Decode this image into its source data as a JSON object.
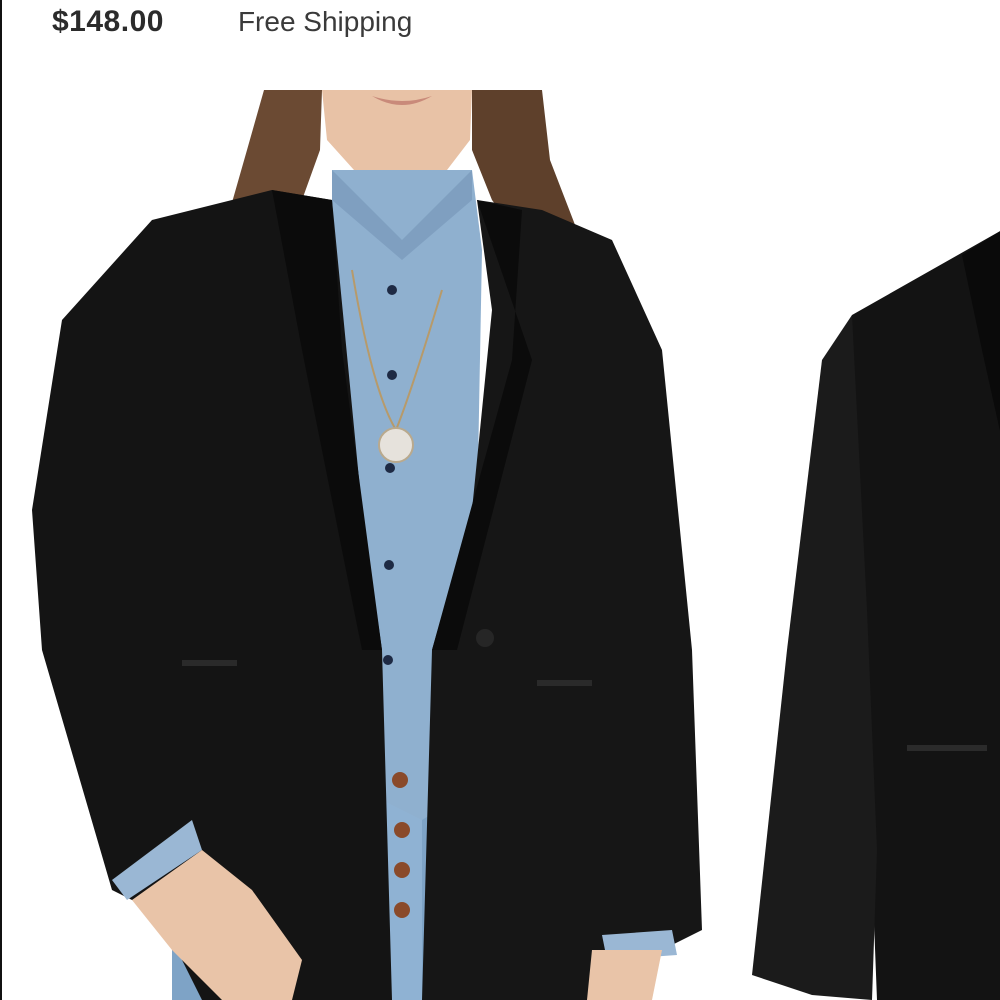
{
  "listing": {
    "price": "$148.00",
    "shipping": "Free Shipping"
  },
  "gallery": {
    "photos": [
      {
        "subject": "model-wearing-black-blazer-over-chambray-shirt"
      },
      {
        "subject": "black-blazer-product-view"
      }
    ]
  }
}
